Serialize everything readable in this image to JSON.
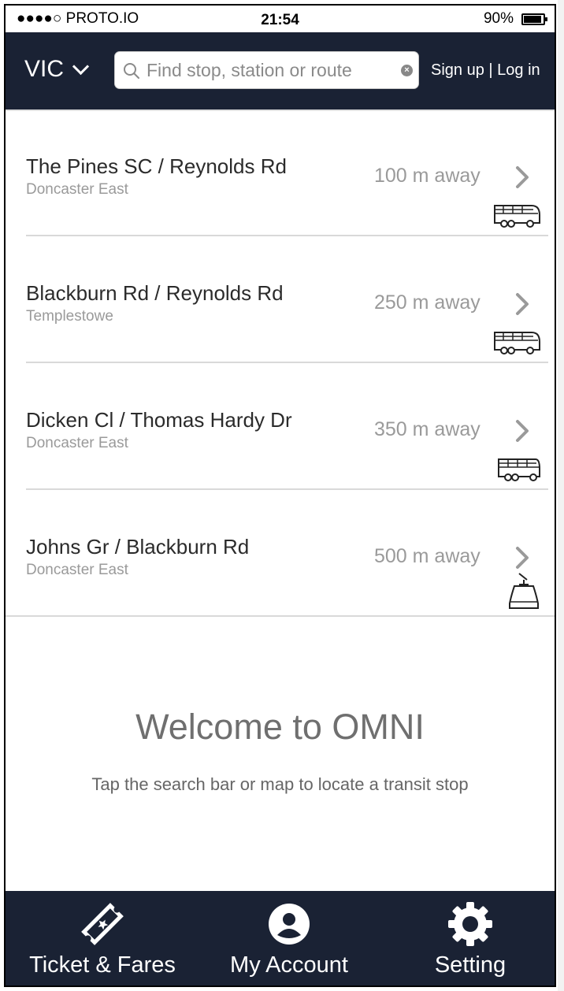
{
  "status_bar": {
    "carrier": "●●●●○ PROTO.IO",
    "time": "21:54",
    "battery": "90%"
  },
  "header": {
    "region": "VIC",
    "search_placeholder": "Find stop, station or route",
    "auth_link": "Sign up | Log in"
  },
  "stops": [
    {
      "name": "The Pines SC / Reynolds Rd",
      "suburb": "Doncaster East",
      "distance": "100 m away",
      "mode": "bus-icon"
    },
    {
      "name": "Blackburn Rd / Reynolds Rd",
      "suburb": "Templestowe",
      "distance": "250 m away",
      "mode": "bus-icon"
    },
    {
      "name": "Dicken Cl / Thomas Hardy Dr",
      "suburb": "Doncaster East",
      "distance": "350 m away",
      "mode": "bus-icon"
    },
    {
      "name": "Johns Gr / Blackburn Rd",
      "suburb": "Doncaster East",
      "distance": "500 m away",
      "mode": "tram-icon"
    }
  ],
  "welcome": {
    "title": "Welcome to OMNI",
    "subtitle": "Tap the search bar or map to locate a transit stop"
  },
  "tabs": [
    {
      "label": "Ticket & Fares",
      "icon": "ticket-icon"
    },
    {
      "label": "My Account",
      "icon": "account-icon"
    },
    {
      "label": "Setting",
      "icon": "gear-icon"
    }
  ],
  "colors": {
    "header_bg": "#1a2234",
    "text_dark": "#2b2b2b",
    "text_muted": "#9a9a9a"
  }
}
